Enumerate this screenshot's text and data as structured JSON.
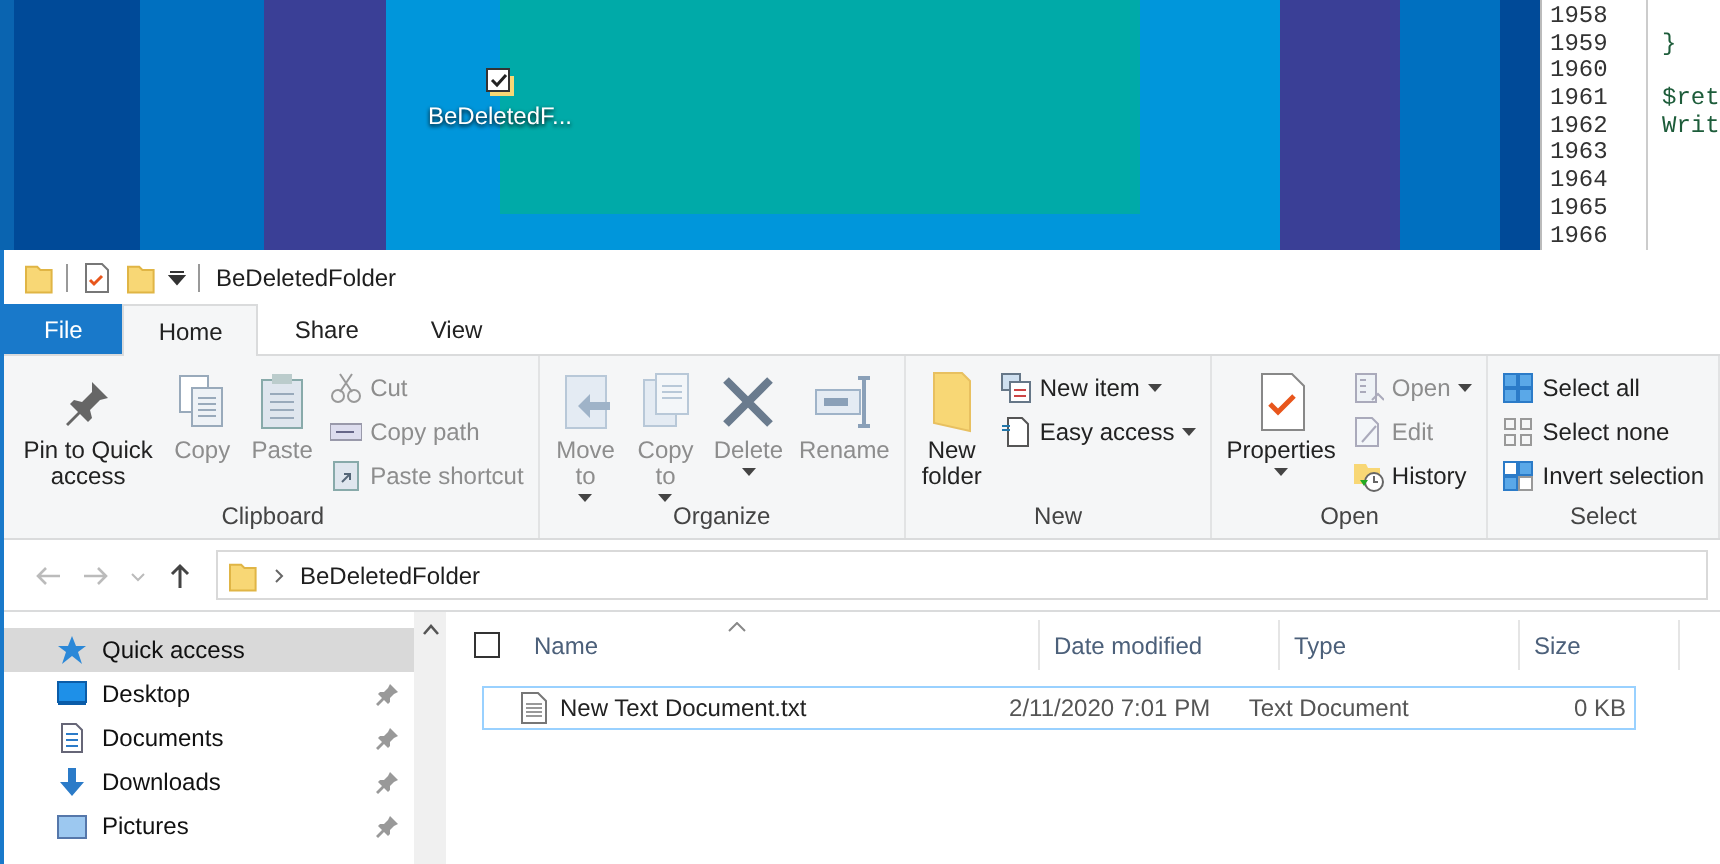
{
  "desktop": {
    "icon": {
      "label": "BeDeletedF..."
    }
  },
  "code_editor": {
    "lines": [
      {
        "number": "1958"
      },
      {
        "number": "1959",
        "text": "}"
      },
      {
        "number": "1960"
      },
      {
        "number": "1961",
        "text": "$ret"
      },
      {
        "number": "1962",
        "text": "Writ"
      },
      {
        "number": "1963"
      },
      {
        "number": "1964"
      },
      {
        "number": "1965"
      },
      {
        "number": "1966"
      }
    ]
  },
  "window": {
    "title": "BeDeletedFolder",
    "tabs": [
      {
        "label": "File",
        "kind": "file",
        "selected": false
      },
      {
        "label": "Home",
        "kind": "tab",
        "selected": true
      },
      {
        "label": "Share",
        "kind": "tab",
        "selected": false
      },
      {
        "label": "View",
        "kind": "tab",
        "selected": false
      }
    ],
    "ribbon": [
      {
        "label": "Clipboard",
        "items": [
          {
            "label": "Pin to Quick access",
            "kind": "large",
            "disabled": false,
            "dropdown": false
          },
          {
            "label": "Copy",
            "kind": "large",
            "disabled": true,
            "dropdown": false
          },
          {
            "label": "Paste",
            "kind": "large",
            "disabled": true,
            "dropdown": false
          },
          {
            "label": "Cut",
            "kind": "small",
            "disabled": true,
            "dropdown": false
          },
          {
            "label": "Copy path",
            "kind": "small",
            "disabled": true,
            "dropdown": false
          },
          {
            "label": "Paste shortcut",
            "kind": "small",
            "disabled": true,
            "dropdown": false
          }
        ]
      },
      {
        "label": "Organize",
        "items": [
          {
            "label": "Move to",
            "kind": "stacked",
            "disabled": true,
            "dropdown": true
          },
          {
            "label": "Copy to",
            "kind": "stacked",
            "disabled": true,
            "dropdown": true
          },
          {
            "label": "Delete",
            "kind": "large",
            "disabled": true,
            "dropdown": true
          },
          {
            "label": "Rename",
            "kind": "large",
            "disabled": true,
            "dropdown": false
          }
        ]
      },
      {
        "label": "New",
        "items": [
          {
            "label": "New folder",
            "kind": "stacked",
            "disabled": false,
            "dropdown": false
          },
          {
            "label": "New item",
            "kind": "small",
            "disabled": false,
            "dropdown": true
          },
          {
            "label": "Easy access",
            "kind": "small",
            "disabled": false,
            "dropdown": true
          }
        ]
      },
      {
        "label": "Open",
        "items": [
          {
            "label": "Properties",
            "kind": "large",
            "disabled": false,
            "dropdown": true
          },
          {
            "label": "Open",
            "kind": "small",
            "disabled": true,
            "dropdown": true
          },
          {
            "label": "Edit",
            "kind": "small",
            "disabled": true,
            "dropdown": false
          },
          {
            "label": "History",
            "kind": "small",
            "disabled": false,
            "dropdown": false
          }
        ]
      },
      {
        "label": "Select",
        "items": [
          {
            "label": "Select all",
            "kind": "small",
            "disabled": false,
            "dropdown": false
          },
          {
            "label": "Select none",
            "kind": "small",
            "disabled": false,
            "dropdown": false
          },
          {
            "label": "Invert selection",
            "kind": "small",
            "disabled": false,
            "dropdown": false
          }
        ]
      }
    ],
    "address": {
      "path": "BeDeletedFolder"
    },
    "nav_pane": [
      {
        "label": "Quick access",
        "selected": true,
        "pinned": false
      },
      {
        "label": "Desktop",
        "selected": false,
        "pinned": true
      },
      {
        "label": "Documents",
        "selected": false,
        "pinned": true
      },
      {
        "label": "Downloads",
        "selected": false,
        "pinned": true
      },
      {
        "label": "Pictures",
        "selected": false,
        "pinned": true
      }
    ],
    "file_list": {
      "select_all_checked": false,
      "columns": [
        "Name",
        "Date modified",
        "Type",
        "Size"
      ],
      "rows": [
        {
          "name": "New Text Document.txt",
          "date_modified": "2/11/2020 7:01 PM",
          "type": "Text Document",
          "size": "0 KB",
          "focused": true
        }
      ]
    }
  }
}
